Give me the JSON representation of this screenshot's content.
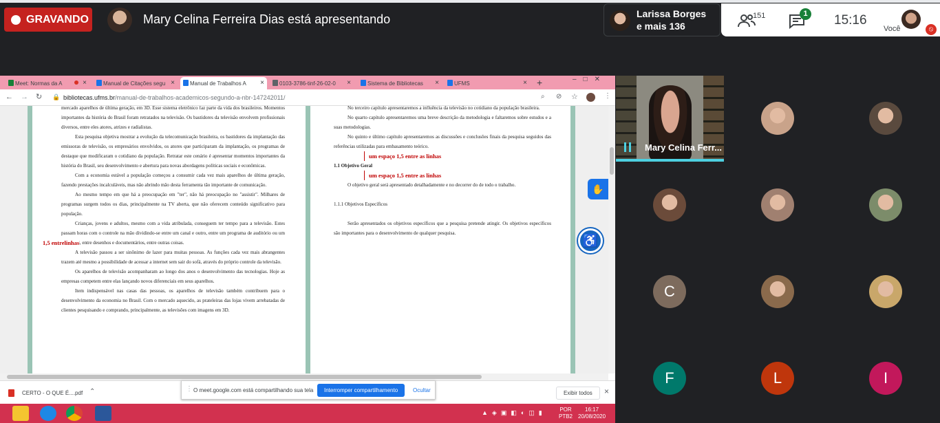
{
  "top": {
    "recording_label": "GRAVANDO",
    "presenter_text": "Mary Celina Ferreira Dias está apresentando",
    "participant_preview_line1": "Larissa Borges",
    "participant_preview_line2": "e mais 136",
    "people_count": "151",
    "chat_badge": "1",
    "time": "15:16",
    "self_label": "Você"
  },
  "browser": {
    "tabs": [
      {
        "label": "Meet: Normas da A",
        "color": "#188038"
      },
      {
        "label": "Manual de Citações segu",
        "color": "#1a73e8"
      },
      {
        "label": "Manual de Trabalhos A",
        "color": "#1a73e8"
      },
      {
        "label": "0103-3786-tinf-26-02-0",
        "color": "#5f6368"
      },
      {
        "label": "Sistema de Bibliotecas",
        "color": "#1a73e8"
      },
      {
        "label": "UFMS",
        "color": "#1a73e8"
      }
    ],
    "url_domain": "bibliotecas.ufms.br",
    "url_path": "/manual-de-trabalhos-academicos-segundo-a-nbr-147242011/"
  },
  "doc_left": {
    "paragraphs": [
      "mercado aparelhos de última geração, em 3D. Esse sistema eletrônico faz parte da vida dos brasileiros. Momentos importantes da história do Brasil foram retratados na televisão. Os bastidores da televisão envolvem profissionais diversos, entre eles atores, atrizes e radialistas.",
      "Esta pesquisa objetiva mostrar a evolução da telecomunicação brasileira, os bastidores da implantação das emissoras de televisão, os empresários envolvidos, os atores que participaram da implantação, os programas de destaque que modificaram o cotidiano da população. Retratar este cenário é apresentar momentos importantes da história do Brasil, seu desenvolvimento e abertura para novas abordagens políticas sociais e econômicas.",
      "Com a economia estável a população começou a consumir cada vez mais aparelhos de última geração, fazendo prestações incalculáveis, mas não abrindo mão desta ferramenta tão importante de comunicação.",
      "Ao mesmo tempo em que há a preocupação em \"ter\", não há preocupação no \"assistir\". Milhares de programas surgem todos os dias, principalmente na TV aberta, que não oferecem conteúdo significativo para população.",
      "Crianças, jovens e adultos, mesmo com a vida atribulada, conseguem ter tempo para a televisão. Estes passam horas com o controle na mão dividindo-se entre um canal e outro, entre um programa de auditório ou um telejornal, entre desenhos e documentários, entre outras coisas.",
      "A televisão passou a ser sinônimo de lazer para muitas pessoas. As funções cada vez mais abrangentes trazem até mesmo a possibilidade de acessar a internet sem sair do sofá, através do próprio controle da televisão.",
      "Os aparelhos de televisão acompanharam ao longo dos anos o desenvolvimento das tecnologias. Hoje as empresas competem entre elas lançando novos diferenciais em seus aparelhos.",
      "Item indispensável nas casas das pessoas, os aparelhos de televisão também contribuem para o desenvolvimento da economia no Brasil. Com o mercado aquecido, as prateleiras das lojas vivem arrebatadas de clientes pesquisando e comprando, principalmente, as televisões com imagens em 3D."
    ],
    "margin_note": "1,5 entrelinhas"
  },
  "doc_right": {
    "p1": "No terceiro capítulo apresentaremos a influência da televisão no cotidiano da população brasileira.",
    "p2": "No quarto capítulo apresentaremos uma breve descrição da metodologia e faltaremos sobre estudos e a suas metodologias.",
    "p3": "No quinto e último capítulo apresentaremos as discussões e conclusões finais da pesquisa seguidos das referências utilizadas para embasamento teórico.",
    "note1": "um espaço 1,5 entre as linhas",
    "heading1": "1.1 Objetivo Geral",
    "note2": "um espaço 1,5 entre as linhas",
    "p4": "O objetivo geral será apresentado detalhadamente e no decorrer do de todo o trabalho.",
    "heading2": "1.1.1 Objetivos Específicos",
    "p5": "Serão apresentados os objetivos específicos que a pesquisa pretende atingir. Os objetivos específicos são importantes para o desenvolvimento de qualquer pesquisa."
  },
  "share_bar": {
    "message": "O meet.google.com está compartilhando sua tela.",
    "stop_label": "Interromper compartilhamento",
    "hide_label": "Ocultar"
  },
  "downloads": {
    "file": "CERTO - O QUE É....pdf",
    "show_all": "Exibir todos"
  },
  "taskbar": {
    "lang": "POR",
    "lang2": "PTB2",
    "time": "16:17",
    "date": "20/08/2020"
  },
  "presenter_tile": {
    "name": "Mary Celina Ferr..."
  },
  "participants": [
    {
      "kind": "photo",
      "color": "#c9a38a"
    },
    {
      "kind": "photo",
      "color": "#5a4a3e"
    },
    {
      "kind": "photo",
      "color": "#6b4b3a"
    },
    {
      "kind": "photo",
      "color": "#a08070"
    },
    {
      "kind": "photo",
      "color": "#7c8c6a"
    },
    {
      "kind": "letter",
      "letter": "C",
      "color": "#7d6b5d"
    },
    {
      "kind": "photo",
      "color": "#8a6a4c"
    },
    {
      "kind": "photo",
      "color": "#c9a76a"
    },
    {
      "kind": "letter",
      "letter": "F",
      "color": "#00796b"
    },
    {
      "kind": "letter",
      "letter": "L",
      "color": "#bf360c"
    },
    {
      "kind": "letter",
      "letter": "I",
      "color": "#c2185b"
    }
  ]
}
